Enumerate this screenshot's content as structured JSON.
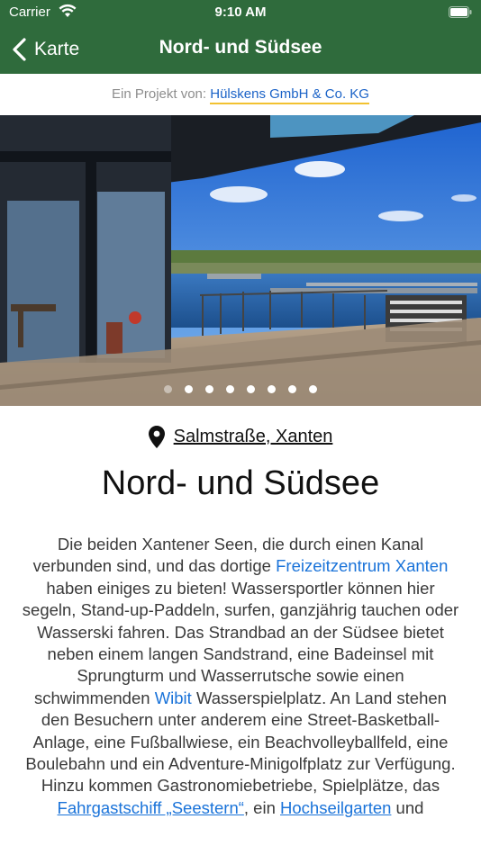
{
  "status": {
    "carrier": "Carrier",
    "time": "9:10 AM"
  },
  "nav": {
    "back_label": "Karte",
    "title": "Nord- und Südsee"
  },
  "project": {
    "prefix": "Ein Projekt von:",
    "company": "Hülskens GmbH & Co. KG"
  },
  "gallery": {
    "dots_total": 8,
    "active_index": 0
  },
  "location": {
    "address": "Salmstraße, Xanten"
  },
  "title": "Nord- und Südsee",
  "description": {
    "t1": "Die beiden Xantener Seen, die durch einen Kanal verbunden sind, und das dortige ",
    "l1": "Freizeitzentrum Xanten",
    "t2": " haben einiges zu bieten! Wassersportler können hier segeln, Stand-up-Paddeln, surfen, ganzjährig tauchen oder Wasserski fahren. Das Strandbad an der Südsee bietet neben einem langen Sandstrand, eine Badeinsel mit Sprungturm und Wasserrutsche sowie einen schwimmenden ",
    "l2": "Wibit",
    "t3": " Wasserspielplatz. An Land stehen den Besuchern unter anderem eine Street-Basketball-Anlage, eine Fußballwiese, ein Beachvolleyballfeld, eine Boulebahn und ein Adventure-Minigolfplatz zur Verfügung. Hinzu kommen Gastronomiebetriebe, Spielplätze, das ",
    "l3": "Fahrgastschiff „Seestern“",
    "t4": ", ein ",
    "l4": "Hochseilgarten",
    "t5": " und"
  },
  "colors": {
    "header": "#2f6b3c",
    "link": "#1a73d9",
    "underline_accent": "#f2c230"
  },
  "icons": {
    "back": "chevron-left-icon",
    "location": "map-pin-icon",
    "wifi": "wifi-icon",
    "battery": "battery-icon"
  }
}
